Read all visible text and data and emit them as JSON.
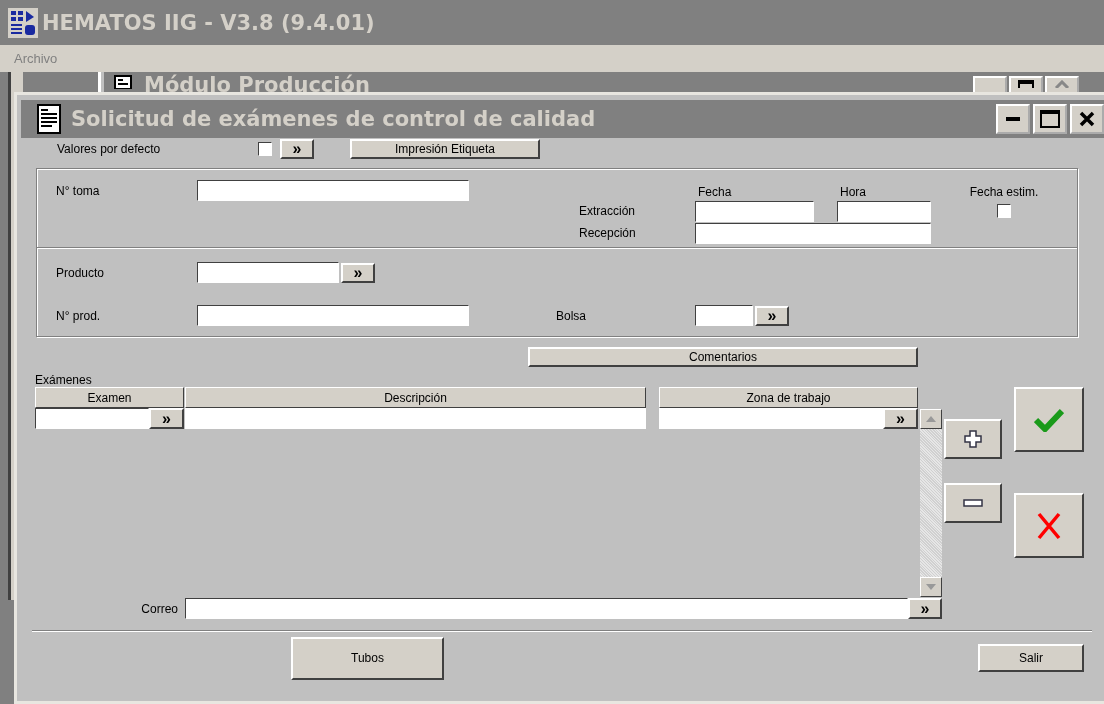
{
  "app": {
    "title": "HEMATOS IIG - V3.8 (9.4.01)"
  },
  "menu": [
    {
      "label": "Archivo",
      "disabled": true
    }
  ],
  "background_window": {
    "title": "Módulo Producción"
  },
  "dialog": {
    "title": "Solicitud de exámenes de control de calidad"
  },
  "defaults": {
    "label": "Valores por defecto",
    "checked": false,
    "button": "»"
  },
  "print_button": "Impresión Etiqueta",
  "toma": {
    "label": "N° toma"
  },
  "dates": {
    "fecha_header": "Fecha",
    "hora_header": "Hora",
    "extraction_label": "Extracción",
    "reception_label": "Recepción",
    "estimated": {
      "label": "Fecha estim.",
      "checked": false
    }
  },
  "product": {
    "label": "Producto",
    "button": "»"
  },
  "prod_number": {
    "label": "N° prod."
  },
  "bag": {
    "label": "Bolsa",
    "button": "»"
  },
  "comments_button": "Comentarios",
  "exams": {
    "label": "Exámenes",
    "columns": [
      "Examen",
      "Descripción",
      "Zona de trabajo"
    ],
    "exam_button": "»",
    "zone_button": "»"
  },
  "mail": {
    "label": "Correo",
    "button": "»"
  },
  "buttons": {
    "tubes": "Tubos",
    "exit": "Salir"
  }
}
